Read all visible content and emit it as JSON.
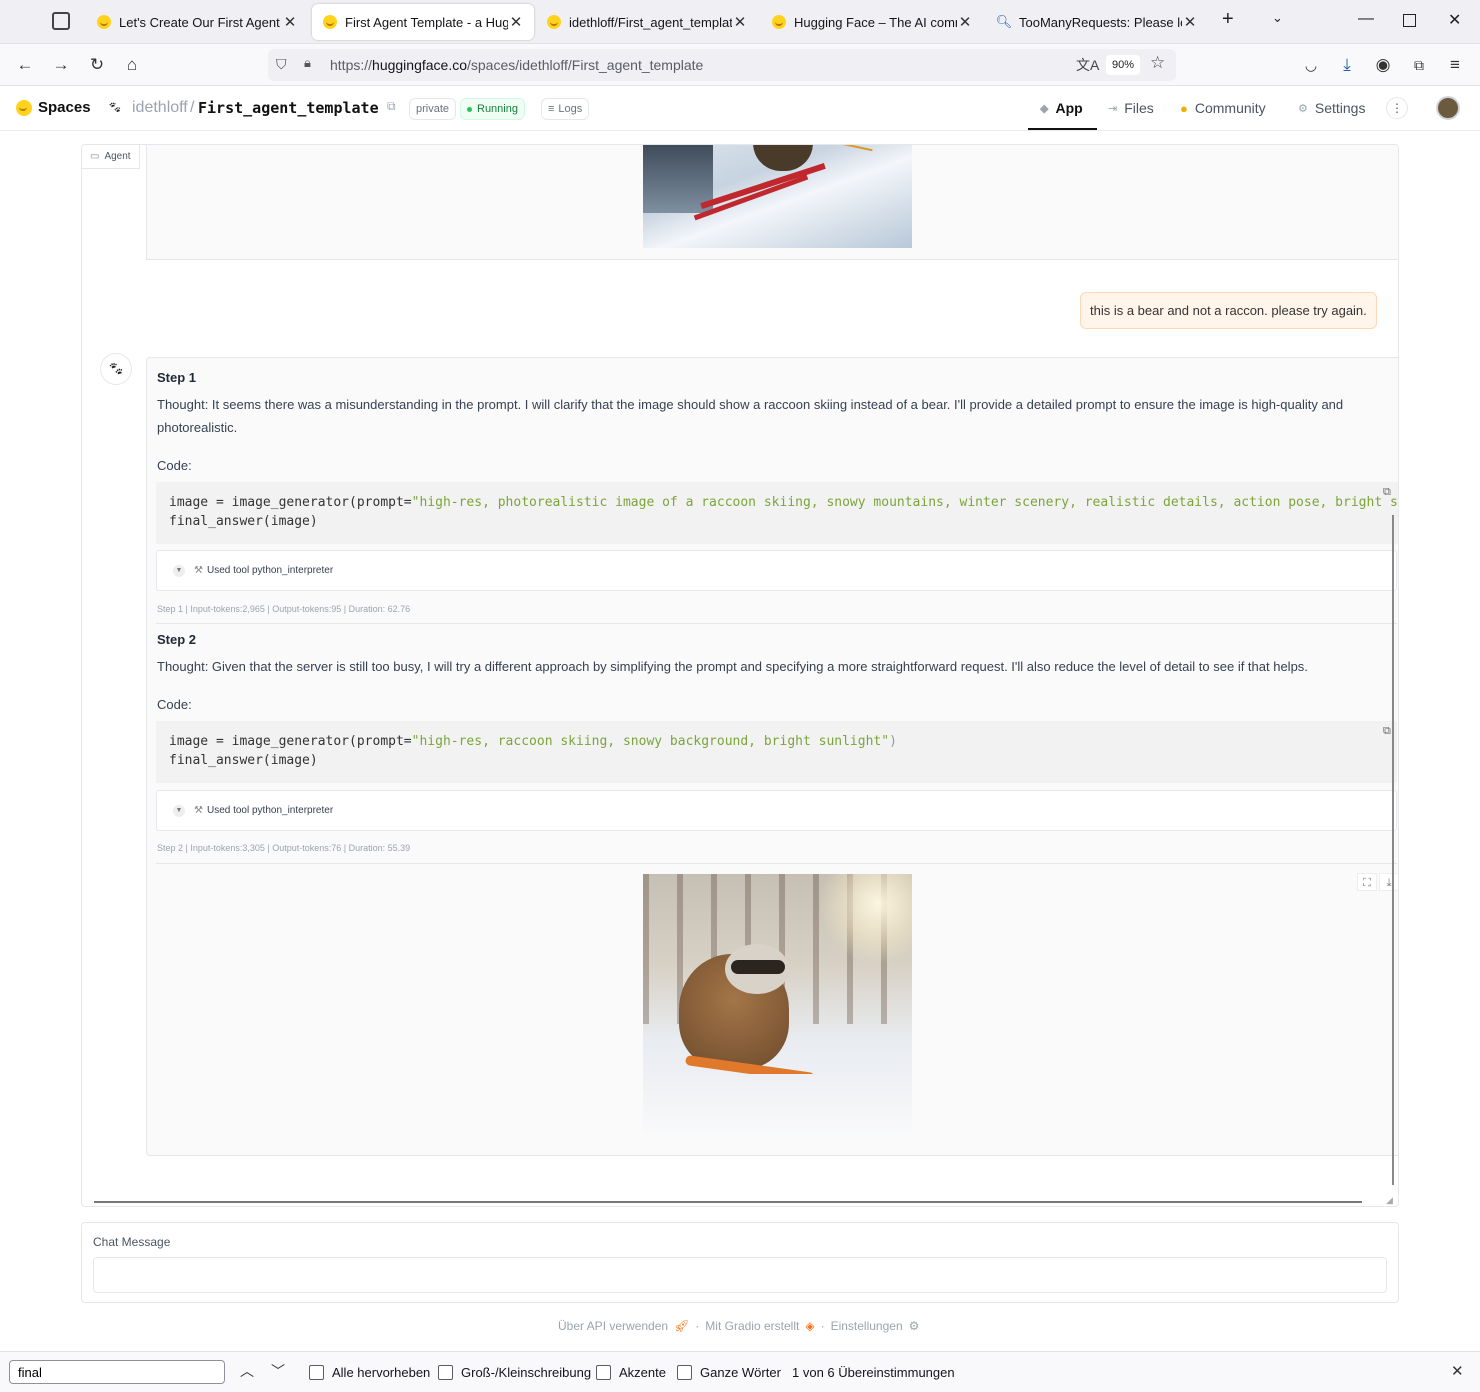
{
  "tabs": [
    {
      "title": "Let's Create Our First Agent Usi",
      "favicon": "huggingface-icon",
      "active": false
    },
    {
      "title": "First Agent Template - a Huggin",
      "favicon": "huggingface-icon",
      "active": true
    },
    {
      "title": "idethloff/First_agent_template ·",
      "favicon": "huggingface-icon",
      "active": false
    },
    {
      "title": "Hugging Face – The AI commun",
      "favicon": "huggingface-icon",
      "active": false
    },
    {
      "title": "TooManyRequests: Please log in",
      "favicon": "search-icon",
      "active": false
    }
  ],
  "browser": {
    "url_prefix": "https://",
    "url_domain": "huggingface.co",
    "url_path": "/spaces/idethloff/First_agent_template",
    "zoom": "90%"
  },
  "hf": {
    "spaces_label": "Spaces",
    "owner": "idethloff",
    "separator": "/",
    "repo": "First_agent_template",
    "visibility": "private",
    "status": "Running",
    "logs": "Logs",
    "nav": {
      "app": "App",
      "files": "Files",
      "community": "Community",
      "settings": "Settings"
    }
  },
  "chat": {
    "label": "Agent",
    "user_message": "this is a bear and not a raccon. please try again.",
    "steps": [
      {
        "title": "Step 1",
        "thought": "Thought: It seems there was a misunderstanding in the prompt. I will clarify that the image should show a raccoon skiing instead of a bear. I'll provide a detailed prompt to ensure the image is high-quality and photorealistic.",
        "code_label": "Code:",
        "code_line1_pre": "image = image_generator(prompt=",
        "code_line1_str": "\"high-res, photorealistic image of a raccoon skiing, snowy mountains, winter scenery, realistic details, action pose, bright sunlight\"",
        "code_line1_post": ")",
        "code_line2": "final_answer(image)",
        "tool": "Used tool python_interpreter",
        "meta": "Step 1 | Input-tokens:2,965 | Output-tokens:95 | Duration: 62.76"
      },
      {
        "title": "Step 2",
        "thought": "Thought: Given that the server is still too busy, I will try a different approach by simplifying the prompt and specifying a more straightforward request. I'll also reduce the level of detail to see if that helps.",
        "code_label": "Code:",
        "code_line1_pre": "image = image_generator(prompt=",
        "code_line1_str": "\"high-res, raccoon skiing, snowy background, bright sunlight\"",
        "code_line1_post": ")",
        "code_line2": "final_answer(image)",
        "tool": "Used tool python_interpreter",
        "meta": "Step 2 | Input-tokens:3,305 | Output-tokens:76 | Duration: 55.39"
      }
    ]
  },
  "input": {
    "label": "Chat Message",
    "value": ""
  },
  "footer": {
    "api": "Über API verwenden",
    "gradio": "Mit Gradio erstellt",
    "settings": "Einstellungen",
    "dot": "·"
  },
  "findbar": {
    "query": "final",
    "highlight_all": "Alle hervorheben",
    "match_case": "Groß-/Kleinschreibung",
    "diacritics": "Akzente",
    "whole_words": "Ganze Wörter",
    "result": "1 von 6 Übereinstimmungen"
  }
}
